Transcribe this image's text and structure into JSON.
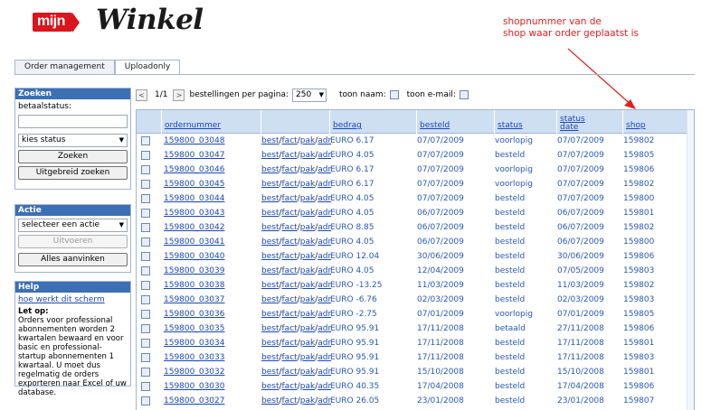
{
  "logo": {
    "mijn": "mijn",
    "winkel": "Winkel"
  },
  "annotation": {
    "line1": "shopnummer van de",
    "line2": "shop waar order geplaatst is"
  },
  "tabs": [
    {
      "label": "Order management",
      "active": false
    },
    {
      "label": "Uploadonly",
      "active": true
    }
  ],
  "search": {
    "title": "Zoeken",
    "status_label": "betaalstatus:",
    "status_select": "kies status",
    "search_button": "Zoeken",
    "advanced_button": "Uitgebreid zoeken"
  },
  "action": {
    "title": "Actie",
    "select": "selecteer een actie",
    "execute_button": "Uitvoeren",
    "check_all_button": "Alles aanvinken"
  },
  "help": {
    "title": "Help",
    "link": "hoe werkt dit scherm",
    "note_title": "Let op:",
    "note_text": "Orders voor professional abonnementen worden 2 kwartalen bewaard en voor basic en professional-startup abonnementen 1 kwartaal. U moet dus regelmatig de orders exporteren naar Excel of uw database."
  },
  "toolbar": {
    "prev": "<",
    "page": "1/1",
    "next": ">",
    "per_page_label": "bestellingen per pagina:",
    "per_page_value": "250",
    "show_name": "toon naam:",
    "show_email": "toon e-mail:"
  },
  "columns": {
    "ordernummer": "ordernummer",
    "bedrag": "bedrag",
    "besteld": "besteld",
    "status": "status",
    "status_date_1": "status",
    "status_date_2": "date",
    "shop": "shop"
  },
  "action_links": {
    "best": "best",
    "fact": "fact",
    "pak": "pak",
    "adr": "adr"
  },
  "orders": [
    {
      "ordernummer": "159800_03048",
      "bedrag": "EURO 6.17",
      "besteld": "07/07/2009",
      "status": "voorlopig",
      "status_date": "07/07/2009",
      "shop": "159802"
    },
    {
      "ordernummer": "159800_03047",
      "bedrag": "EURO 4.05",
      "besteld": "07/07/2009",
      "status": "besteld",
      "status_date": "07/07/2009",
      "shop": "159805"
    },
    {
      "ordernummer": "159800_03046",
      "bedrag": "EURO 6.17",
      "besteld": "07/07/2009",
      "status": "voorlopig",
      "status_date": "07/07/2009",
      "shop": "159806"
    },
    {
      "ordernummer": "159800_03045",
      "bedrag": "EURO 6.17",
      "besteld": "07/07/2009",
      "status": "voorlopig",
      "status_date": "07/07/2009",
      "shop": "159802"
    },
    {
      "ordernummer": "159800_03044",
      "bedrag": "EURO 4.05",
      "besteld": "07/07/2009",
      "status": "besteld",
      "status_date": "07/07/2009",
      "shop": "159800"
    },
    {
      "ordernummer": "159800_03043",
      "bedrag": "EURO 4.05",
      "besteld": "06/07/2009",
      "status": "besteld",
      "status_date": "06/07/2009",
      "shop": "159801"
    },
    {
      "ordernummer": "159800_03042",
      "bedrag": "EURO 8.85",
      "besteld": "06/07/2009",
      "status": "besteld",
      "status_date": "06/07/2009",
      "shop": "159802"
    },
    {
      "ordernummer": "159800_03041",
      "bedrag": "EURO 4.05",
      "besteld": "06/07/2009",
      "status": "besteld",
      "status_date": "06/07/2009",
      "shop": "159800"
    },
    {
      "ordernummer": "159800_03040",
      "bedrag": "EURO 12.04",
      "besteld": "30/06/2009",
      "status": "besteld",
      "status_date": "30/06/2009",
      "shop": "159806"
    },
    {
      "ordernummer": "159800_03039",
      "bedrag": "EURO 4.05",
      "besteld": "12/04/2009",
      "status": "besteld",
      "status_date": "07/05/2009",
      "shop": "159803"
    },
    {
      "ordernummer": "159800_03038",
      "bedrag": "EURO -13.25",
      "besteld": "11/03/2009",
      "status": "besteld",
      "status_date": "11/03/2009",
      "shop": "159802"
    },
    {
      "ordernummer": "159800_03037",
      "bedrag": "EURO -6.76",
      "besteld": "02/03/2009",
      "status": "besteld",
      "status_date": "02/03/2009",
      "shop": "159803"
    },
    {
      "ordernummer": "159800_03036",
      "bedrag": "EURO -2.75",
      "besteld": "07/01/2009",
      "status": "voorlopig",
      "status_date": "07/01/2009",
      "shop": "159805"
    },
    {
      "ordernummer": "159800_03035",
      "bedrag": "EURO 95.91",
      "besteld": "17/11/2008",
      "status": "betaald",
      "status_date": "27/11/2008",
      "shop": "159806"
    },
    {
      "ordernummer": "159800_03034",
      "bedrag": "EURO 95.91",
      "besteld": "17/11/2008",
      "status": "besteld",
      "status_date": "17/11/2008",
      "shop": "159801"
    },
    {
      "ordernummer": "159800_03033",
      "bedrag": "EURO 95.91",
      "besteld": "17/11/2008",
      "status": "besteld",
      "status_date": "17/11/2008",
      "shop": "159803"
    },
    {
      "ordernummer": "159800_03032",
      "bedrag": "EURO 95.91",
      "besteld": "15/10/2008",
      "status": "besteld",
      "status_date": "15/10/2008",
      "shop": "159801"
    },
    {
      "ordernummer": "159800_03030",
      "bedrag": "EURO 40.35",
      "besteld": "17/04/2008",
      "status": "besteld",
      "status_date": "17/04/2008",
      "shop": "159806"
    },
    {
      "ordernummer": "159800_03027",
      "bedrag": "EURO 26.05",
      "besteld": "23/01/2008",
      "status": "besteld",
      "status_date": "23/01/2008",
      "shop": "159807"
    }
  ],
  "colors": {
    "panel_header": "#3d6fb4",
    "grid_header": "#cfdff2",
    "link": "#1a47b8",
    "annotation": "#e1201f",
    "logo_red": "#d8161b"
  }
}
